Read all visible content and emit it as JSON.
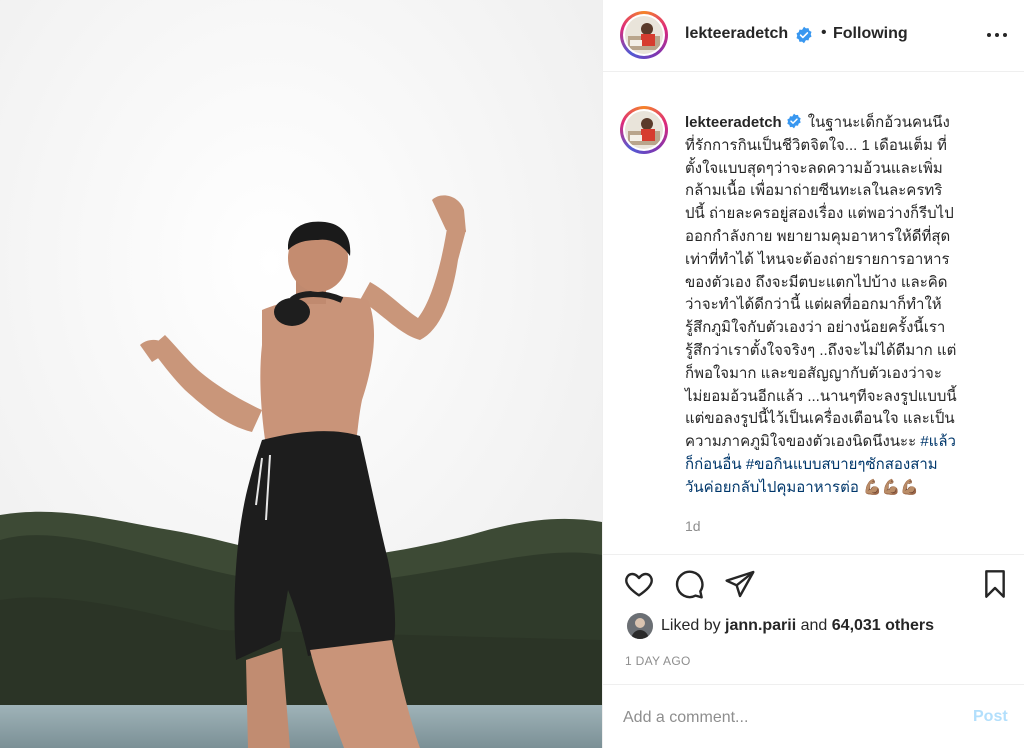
{
  "post": {
    "photo_alt": "",
    "author": {
      "username": "lekteeradetch",
      "verified": true
    },
    "header": {
      "separator": "•",
      "follow_status": "Following",
      "more_icon": "more-options-icon"
    },
    "caption": {
      "lines": [
        "ในฐานะเด็กอ้วนคนนึง",
        "ที่รักการกินเป็นชีวิตจิตใจ... 1 เดือนเต็ม ที่",
        "ตั้งใจแบบสุดๆว่าจะลดความอ้วนและเพิ่ม",
        "กล้ามเนื้อ เพื่อมาถ่ายซีนทะเลในละครทริ",
        "ปนี้ ถ่ายละครอยู่สองเรื่อง แต่พอว่างก็รีบไป",
        "ออกกำลังกาย พยายามคุมอาหารให้ดีที่สุด",
        "เท่าที่ทำได้ ไหนจะต้องถ่ายรายการอาหาร",
        "ของตัวเอง ถึงจะมีตบะแตกไปบ้าง และคิด",
        "ว่าจะทำได้ดีกว่านี้ แต่ผลที่ออกมาก็ทำให้",
        "รู้สึกภูมิใจกับตัวเองว่า อย่างน้อยครั้งนี้เรา",
        "รู้สึกว่าเราตั้งใจจริงๆ ..ถึงจะไม่ได้ดีมาก แต่",
        "ก็พอใจมาก และขอสัญญากับตัวเองว่าจะ",
        "ไม่ยอมอ้วนอีกแล้ว ...นานๆทีจะลงรูปแบบนี้",
        "แต่ขอลงรูปนี้ไว้เป็นเครื่องเตือนใจ และเป็น"
      ],
      "line_14_text": "ความภาคภูมิใจของตัวเองนิดนึงนะะ ",
      "hashtag_1a": "#แล้ว",
      "hashtag_1b": "ก็ก่อนอื่น",
      "hashtag_2a": "#ขอกินแบบสบายๆซักสองสาม",
      "hashtag_2b": "วันค่อยกลับไปคุมอาหารต่อ",
      "emoji": "💪🏽💪🏽💪🏽"
    },
    "age": "1d",
    "actions": {
      "like_icon": "heart-icon",
      "comment_icon": "comment-icon",
      "share_icon": "paper-plane-icon",
      "save_icon": "bookmark-icon"
    },
    "likes": {
      "prefix": "Liked by ",
      "liker": "jann.parii",
      "middle": " and ",
      "others": "64,031 others"
    },
    "timestamp": "1 DAY AGO",
    "comment": {
      "placeholder": "Add a comment...",
      "post_label": "Post"
    }
  },
  "colors": {
    "accent": "#0095f6",
    "post_disabled": "#b2dffc",
    "hashtag": "#00376b",
    "muted": "#8e8e8e"
  }
}
